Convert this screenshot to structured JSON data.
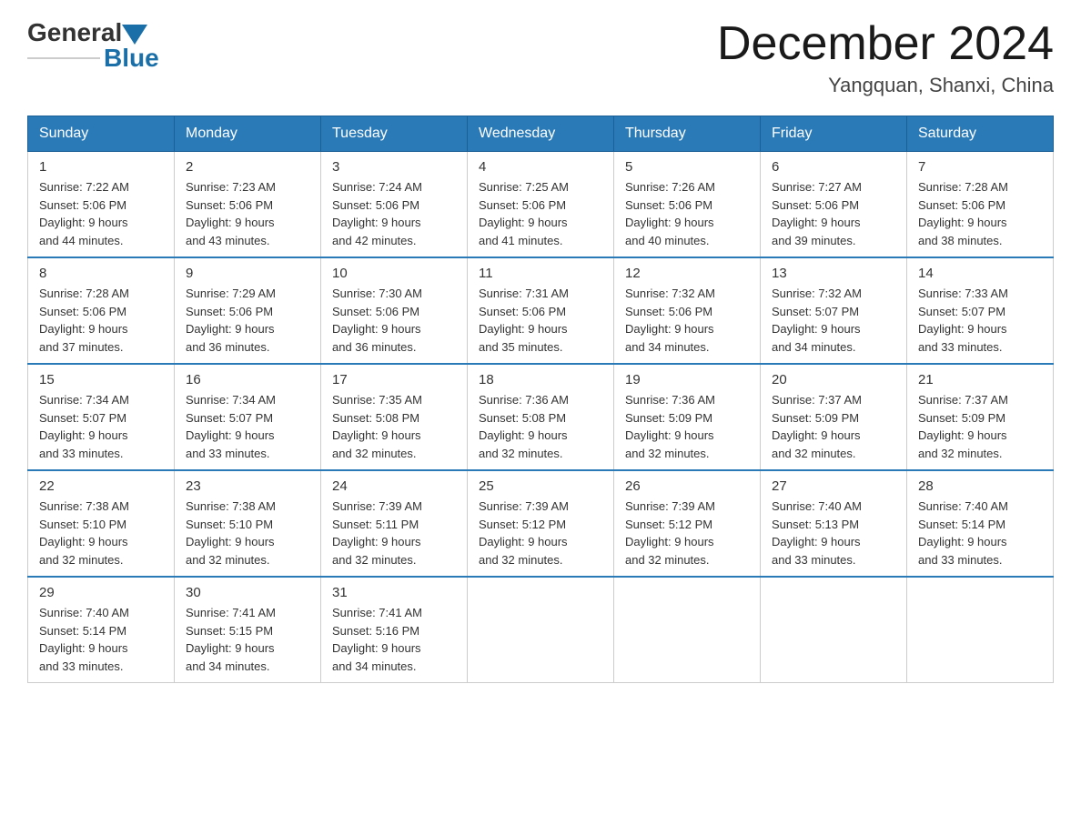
{
  "logo": {
    "general": "General",
    "blue": "Blue",
    "triangle_color": "#1a6fa8"
  },
  "header": {
    "month_year": "December 2024",
    "location": "Yangquan, Shanxi, China"
  },
  "weekdays": [
    "Sunday",
    "Monday",
    "Tuesday",
    "Wednesday",
    "Thursday",
    "Friday",
    "Saturday"
  ],
  "weeks": [
    [
      {
        "day": "1",
        "sunrise": "7:22 AM",
        "sunset": "5:06 PM",
        "daylight": "9 hours and 44 minutes."
      },
      {
        "day": "2",
        "sunrise": "7:23 AM",
        "sunset": "5:06 PM",
        "daylight": "9 hours and 43 minutes."
      },
      {
        "day": "3",
        "sunrise": "7:24 AM",
        "sunset": "5:06 PM",
        "daylight": "9 hours and 42 minutes."
      },
      {
        "day": "4",
        "sunrise": "7:25 AM",
        "sunset": "5:06 PM",
        "daylight": "9 hours and 41 minutes."
      },
      {
        "day": "5",
        "sunrise": "7:26 AM",
        "sunset": "5:06 PM",
        "daylight": "9 hours and 40 minutes."
      },
      {
        "day": "6",
        "sunrise": "7:27 AM",
        "sunset": "5:06 PM",
        "daylight": "9 hours and 39 minutes."
      },
      {
        "day": "7",
        "sunrise": "7:28 AM",
        "sunset": "5:06 PM",
        "daylight": "9 hours and 38 minutes."
      }
    ],
    [
      {
        "day": "8",
        "sunrise": "7:28 AM",
        "sunset": "5:06 PM",
        "daylight": "9 hours and 37 minutes."
      },
      {
        "day": "9",
        "sunrise": "7:29 AM",
        "sunset": "5:06 PM",
        "daylight": "9 hours and 36 minutes."
      },
      {
        "day": "10",
        "sunrise": "7:30 AM",
        "sunset": "5:06 PM",
        "daylight": "9 hours and 36 minutes."
      },
      {
        "day": "11",
        "sunrise": "7:31 AM",
        "sunset": "5:06 PM",
        "daylight": "9 hours and 35 minutes."
      },
      {
        "day": "12",
        "sunrise": "7:32 AM",
        "sunset": "5:06 PM",
        "daylight": "9 hours and 34 minutes."
      },
      {
        "day": "13",
        "sunrise": "7:32 AM",
        "sunset": "5:07 PM",
        "daylight": "9 hours and 34 minutes."
      },
      {
        "day": "14",
        "sunrise": "7:33 AM",
        "sunset": "5:07 PM",
        "daylight": "9 hours and 33 minutes."
      }
    ],
    [
      {
        "day": "15",
        "sunrise": "7:34 AM",
        "sunset": "5:07 PM",
        "daylight": "9 hours and 33 minutes."
      },
      {
        "day": "16",
        "sunrise": "7:34 AM",
        "sunset": "5:07 PM",
        "daylight": "9 hours and 33 minutes."
      },
      {
        "day": "17",
        "sunrise": "7:35 AM",
        "sunset": "5:08 PM",
        "daylight": "9 hours and 32 minutes."
      },
      {
        "day": "18",
        "sunrise": "7:36 AM",
        "sunset": "5:08 PM",
        "daylight": "9 hours and 32 minutes."
      },
      {
        "day": "19",
        "sunrise": "7:36 AM",
        "sunset": "5:09 PM",
        "daylight": "9 hours and 32 minutes."
      },
      {
        "day": "20",
        "sunrise": "7:37 AM",
        "sunset": "5:09 PM",
        "daylight": "9 hours and 32 minutes."
      },
      {
        "day": "21",
        "sunrise": "7:37 AM",
        "sunset": "5:09 PM",
        "daylight": "9 hours and 32 minutes."
      }
    ],
    [
      {
        "day": "22",
        "sunrise": "7:38 AM",
        "sunset": "5:10 PM",
        "daylight": "9 hours and 32 minutes."
      },
      {
        "day": "23",
        "sunrise": "7:38 AM",
        "sunset": "5:10 PM",
        "daylight": "9 hours and 32 minutes."
      },
      {
        "day": "24",
        "sunrise": "7:39 AM",
        "sunset": "5:11 PM",
        "daylight": "9 hours and 32 minutes."
      },
      {
        "day": "25",
        "sunrise": "7:39 AM",
        "sunset": "5:12 PM",
        "daylight": "9 hours and 32 minutes."
      },
      {
        "day": "26",
        "sunrise": "7:39 AM",
        "sunset": "5:12 PM",
        "daylight": "9 hours and 32 minutes."
      },
      {
        "day": "27",
        "sunrise": "7:40 AM",
        "sunset": "5:13 PM",
        "daylight": "9 hours and 33 minutes."
      },
      {
        "day": "28",
        "sunrise": "7:40 AM",
        "sunset": "5:14 PM",
        "daylight": "9 hours and 33 minutes."
      }
    ],
    [
      {
        "day": "29",
        "sunrise": "7:40 AM",
        "sunset": "5:14 PM",
        "daylight": "9 hours and 33 minutes."
      },
      {
        "day": "30",
        "sunrise": "7:41 AM",
        "sunset": "5:15 PM",
        "daylight": "9 hours and 34 minutes."
      },
      {
        "day": "31",
        "sunrise": "7:41 AM",
        "sunset": "5:16 PM",
        "daylight": "9 hours and 34 minutes."
      },
      null,
      null,
      null,
      null
    ]
  ],
  "labels": {
    "sunrise": "Sunrise:",
    "sunset": "Sunset:",
    "daylight": "Daylight:"
  }
}
